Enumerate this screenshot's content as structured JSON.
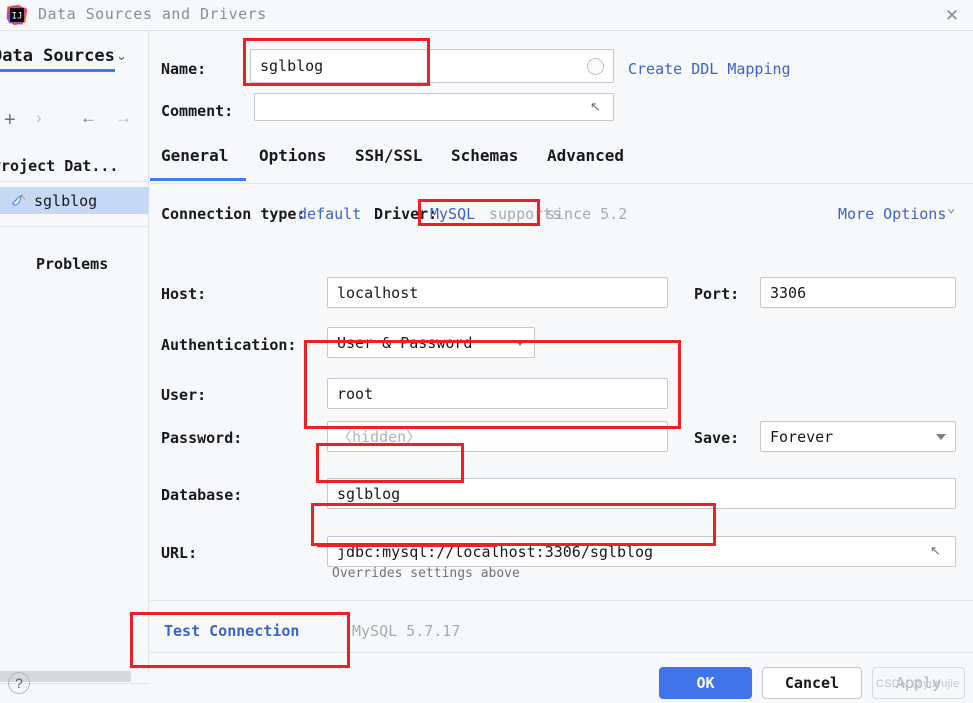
{
  "window": {
    "title": "Data Sources and Drivers",
    "close_label": "✕",
    "logo_name": "intellij-idea-logo"
  },
  "sidebar": {
    "header": "Data Sources",
    "header_chevron": "⌄",
    "toolbar": [
      {
        "name": "add-button",
        "glyph": "+",
        "enabled": true
      },
      {
        "name": "duplicate-button",
        "glyph": "›",
        "enabled": false
      },
      {
        "name": "back-button",
        "glyph": "←",
        "enabled": true
      },
      {
        "name": "forward-button",
        "glyph": "→",
        "enabled": false
      }
    ],
    "section": "Project Dat...",
    "items": [
      {
        "label": "sglblog",
        "icon": "mysql-dolphin-icon",
        "selected": true
      }
    ],
    "problems_label": "Problems",
    "help_label": "?"
  },
  "form": {
    "name_label": "Name:",
    "name_value": "sglblog",
    "name_color_picker": "color-circle-icon",
    "create_ddl_mapping": "Create DDL Mapping",
    "comment_label": "Comment:",
    "comment_value": "",
    "comment_expand": "expand-icon"
  },
  "tabs": [
    {
      "label": "General",
      "active": true
    },
    {
      "label": "Options",
      "active": false
    },
    {
      "label": "SSH/SSL",
      "active": false
    },
    {
      "label": "Schemas",
      "active": false
    },
    {
      "label": "Advanced",
      "active": false
    }
  ],
  "connection_row": {
    "connection_type_label": "Connection type:",
    "connection_type_value": "default",
    "driver_label": "Driver:",
    "driver_value": "MySQL",
    "driver_suffix": "supports",
    "driver_since": "since 5.2",
    "more_options": "More Options",
    "more_options_chevron": "⌄"
  },
  "general": {
    "host_label": "Host:",
    "host_value": "localhost",
    "port_label": "Port:",
    "port_value": "3306",
    "authentication_label": "Authentication:",
    "authentication_value": "User & Password",
    "user_label": "User:",
    "user_value": "root",
    "password_label": "Password:",
    "password_placeholder": "〈hidden〉",
    "save_label": "Save:",
    "save_value": "Forever",
    "database_label": "Database:",
    "database_value": "sglblog",
    "url_label": "URL:",
    "url_value": "jdbc:mysql://localhost:3306/sglblog",
    "url_hint": "Overrides settings above",
    "url_expand": "expand-icon"
  },
  "footer": {
    "test_connection": "Test Connection",
    "driver_version": "MySQL 5.7.17"
  },
  "dialog_buttons": {
    "ok": "OK",
    "cancel": "Cancel",
    "apply": "Apply"
  },
  "watermark": "CSDN @yuyujie",
  "colors": {
    "accent": "#3d7ff0",
    "primary_button": "#4074e8",
    "link": "#3d62c9",
    "annotation": "#ed2024",
    "selection": "#c7d8f5",
    "background": "#f7f8fa",
    "muted_text": "#a7abb2"
  }
}
